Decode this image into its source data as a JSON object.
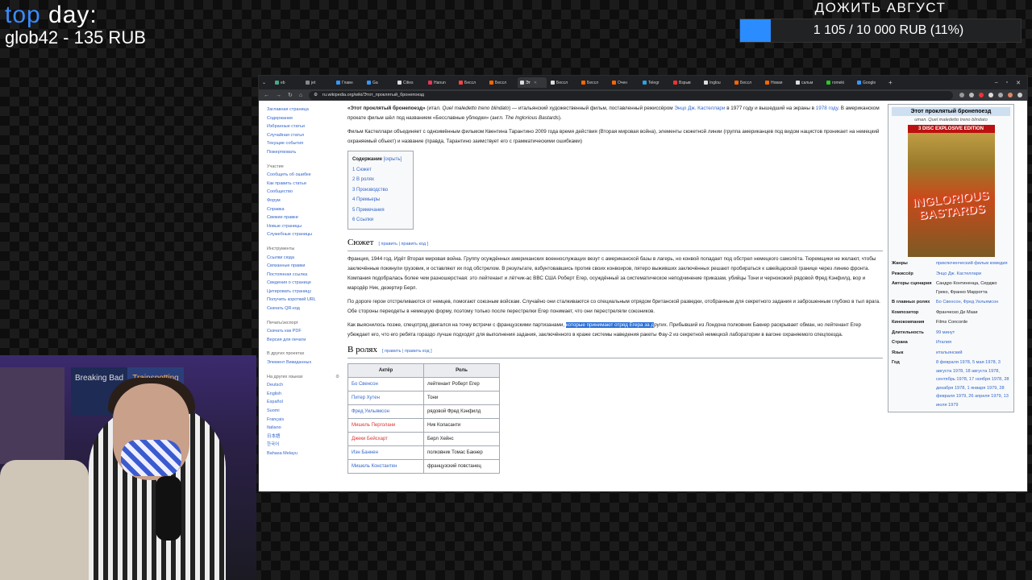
{
  "overlay": {
    "top_day_prefix": "top ",
    "top_day_accent": "day",
    "top_day_suffix": ":",
    "top_donor": "glob42 - 135 RUB",
    "goal_title": "ДОЖИТЬ АВГУСТ",
    "goal_text": "1 105 / 10 000 RUB (11%)",
    "goal_progress": 0.11
  },
  "browser": {
    "tabs": [
      {
        "label": "eb",
        "color": "#4a8"
      },
      {
        "label": "jet",
        "color": "#888"
      },
      {
        "label": "Главн",
        "color": "#39f"
      },
      {
        "label": "Ga",
        "color": "#39f"
      },
      {
        "label": "Cities",
        "color": "#ddd"
      },
      {
        "label": "Hanun",
        "color": "#e35"
      },
      {
        "label": "Бессл",
        "color": "#f44"
      },
      {
        "label": "Бессл",
        "color": "#f60"
      },
      {
        "label": "Эт",
        "color": "#ddd",
        "active": true
      },
      {
        "label": "Бессл",
        "color": "#ddd"
      },
      {
        "label": "Бессл",
        "color": "#f60"
      },
      {
        "label": "Очен",
        "color": "#f60"
      },
      {
        "label": "Telegr",
        "color": "#2aa3e0"
      },
      {
        "label": "Взрыв",
        "color": "#e33"
      },
      {
        "label": "Inglou",
        "color": "#ddd"
      },
      {
        "label": "Бессл",
        "color": "#f60"
      },
      {
        "label": "Новая",
        "color": "#f60"
      },
      {
        "label": "сальм",
        "color": "#ddd"
      },
      {
        "label": "romeki",
        "color": "#2c2"
      },
      {
        "label": "Google",
        "color": "#39f"
      }
    ],
    "url": "ru.wikipedia.org/wiki/Этот_проклятый_бронепоезд"
  },
  "sidebar": {
    "nav": [
      "Заглавная страница",
      "Содержание",
      "Избранные статьи",
      "Случайная статья",
      "Текущие события",
      "Пожертвовать"
    ],
    "participation_header": "Участие",
    "participation": [
      "Сообщить об ошибке",
      "Как править статьи",
      "Сообщество",
      "Форум",
      "Справка",
      "Свежие правки",
      "Новые страницы",
      "Служебные страницы"
    ],
    "tools_header": "Инструменты",
    "tools": [
      "Ссылки сюда",
      "Связанные правки",
      "Постоянная ссылка",
      "Сведения о странице",
      "Цитировать страницу",
      "Получить короткий URL",
      "Скачать QR-код"
    ],
    "print_header": "Печать/экспорт",
    "print": [
      "Скачать как PDF",
      "Версия для печати"
    ],
    "other_header": "В других проектах",
    "other": [
      "Элемент Викиданных"
    ],
    "lang_header": "На других языках",
    "langs": [
      "Deutsch",
      "English",
      "Español",
      "Suomi",
      "Français",
      "Italiano",
      "日本語",
      "한국어",
      "Bahasa Melayu"
    ]
  },
  "article": {
    "intro1_bold": "«Этот проклятый бронепоезд»",
    "intro1_a": " (итал. ",
    "intro1_it": "Quel maledetto treno blindato",
    "intro1_b": ") — итальянский художественный фильм, поставленный режиссёром ",
    "intro1_dir": "Энцо Дж. Кастеллари",
    "intro1_c": " в 1977 году",
    "intro1_d": " и вышедший на экраны в ",
    "intro1_year": "1978 году",
    "intro1_e": ". В американском прокате фильм шёл под названием «Бесславные ублюдки» (англ. ",
    "intro1_en": "The Inglorious Bastards",
    "intro1_f": ").",
    "intro2": "Фильм Кастеллари объединяет с одноимённым фильмом Квентина Тарантино 2009 года время действия (Вторая мировая война), элементы сюжетной линии (группа американцев под видом нацистов проникает на немецкий охраняемый объект) и название (правда, Тарантино заимствует его с грамматическими ошибками)",
    "toc_title": "Содержание",
    "toc_hide": "[скрыть]",
    "toc": [
      "1  Сюжет",
      "2  В ролях",
      "3  Производство",
      "4  Премьеры",
      "5  Примечания",
      "6  Ссылки"
    ],
    "h_plot": "Сюжет",
    "edit_links": "[ править | править код ]",
    "plot1": "Франция, 1944 год. Идёт Вторая мировая война. Группу осуждённых американских военнослужащих везут с американской базы в лагерь, но конвой попадает под обстрел немецкого самолёта. Тюремщики не желают, чтобы заключённые покинули грузовик, и оставляют их под обстрелом. В результате, взбунтовавшись против своих конвоиров, пятеро выживших заключённых решают пробираться к швейцарской границе через линию фронта. Компания подобралась более чем разношерстная: это лейтенант и лётчик-ас ВВС США Роберт Егер, осуждённый за систематическое неподчинение приказам, убийцы Тони и чернокожий рядовой Фред Кэнфилд, вор и мародёр Ник, дезертир Берл.",
    "plot2": "По дороге герои отстреливаются от немцев, помогают союзным войскам. Случайно они сталкиваются со специальным отрядом британской разведки, отобранным для секретного задания и заброшенным глубоко в тыл врага. Обе стороны переодеты в немецкую форму, поэтому только после перестрелки Егер понимает, что они перестреляли союзников.",
    "plot3_a": "Как выяснилось позже, спецотряд двигался на точку встречи с французскими партизанами, ",
    "plot3_hl": "которые принимают отряд Егера за д",
    "plot3_b": "ругих. Прибывший из Лондона полковник Бакнер раскрывает обман, но лейтенант Егер убеждает его, что его ребята гораздо лучше подходят для выполнения задания, заключённого в краже системы наведения ракеты Фау-2 из секретной немецкой лаборатории в вагоне охраняемого спецпоезда.",
    "h_cast": "В ролях",
    "cast_headers": [
      "Актёр",
      "Роль"
    ],
    "cast": [
      {
        "actor": "Бо Свенсон",
        "role": "лейтенант Роберт Егер",
        "red": false
      },
      {
        "actor": "Питер Хутен",
        "role": "Тони",
        "red": false
      },
      {
        "actor": "Фред Уильямсон",
        "role": "рядовой Фред Кэнфилд",
        "red": false
      },
      {
        "actor": "Мишель Перголани",
        "role": "Ник Коласанти",
        "red": true
      },
      {
        "actor": "Джеки Бейсхарт",
        "role": "Берл Хейнс",
        "red": true
      },
      {
        "actor": "Иэн Баннен",
        "role": "полковник Томас Бакнер",
        "red": false
      },
      {
        "actor": "Мишель Константен",
        "role": "французский повстанец",
        "red": false
      }
    ]
  },
  "infobox": {
    "title": "Этот проклятый бронепоезд",
    "subtitle": "итал. Quel maledetto treno blindato",
    "poster_band": "3 DISC EXPLOSIVE EDITION",
    "poster_title": "INGLORIOUS BASTARDS",
    "rows": [
      {
        "k": "Жанры",
        "v": "приключенческий фильм комедия",
        "plain": false
      },
      {
        "k": "Режиссёр",
        "v": "Энцо Дж. Кастеллари",
        "plain": false
      },
      {
        "k": "Авторы сценария",
        "v": "Сандро Континенца, Серджо Греко, Франко Марротта",
        "plain": true
      },
      {
        "k": "В главных ролях",
        "v": "Бо Свенсон, Фред Уильямсон",
        "plain": false
      },
      {
        "k": "Композитор",
        "v": "Франческо Де Мази",
        "plain": true
      },
      {
        "k": "Кинокомпания",
        "v": "Films Concorde",
        "plain": true
      },
      {
        "k": "Длительность",
        "v": "99 минут",
        "plain": false
      },
      {
        "k": "Страна",
        "v": "Италия",
        "plain": false
      },
      {
        "k": "Язык",
        "v": "итальянский",
        "plain": false
      },
      {
        "k": "Год",
        "v": "8 февраля 1978, 5 мая 1978, 3 августа 1978, 18 августа 1978, сентябрь 1978, 17 ноября 1978, 28 декабря 1978, 1 января 1979, 28 февраля 1979, 26 апреля 1979, 13 июля 1979",
        "plain": false
      }
    ]
  },
  "webcam": {
    "poster2": "Breaking Bad",
    "poster3": "Trainspotting"
  }
}
